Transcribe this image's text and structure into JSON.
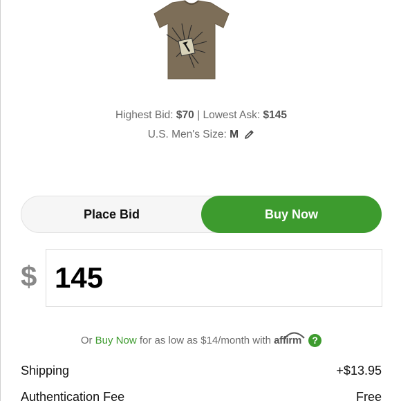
{
  "product": {
    "image_icon": "tshirt-image",
    "shirt_color": "#7d6e58"
  },
  "bids": {
    "highest_bid_label": "Highest Bid:",
    "highest_bid_value": "$70",
    "separator": "|",
    "lowest_ask_label": "Lowest Ask:",
    "lowest_ask_value": "$145"
  },
  "size": {
    "label": "U.S. Men's Size:",
    "value": "M",
    "edit_icon": "pencil-icon"
  },
  "toggle": {
    "place_bid_label": "Place Bid",
    "buy_now_label": "Buy Now",
    "selected": "Buy Now",
    "accent_color": "#3d9b2e"
  },
  "price": {
    "currency_symbol": "$",
    "value": "145"
  },
  "financing": {
    "prefix": "Or",
    "link_text": "Buy Now",
    "middle": "for as low as $14/month with",
    "provider": "affirm",
    "help_icon": "question-icon",
    "help_symbol": "?"
  },
  "fees": [
    {
      "label": "Shipping",
      "value": "+$13.95"
    },
    {
      "label": "Authentication Fee",
      "value": "Free"
    }
  ]
}
